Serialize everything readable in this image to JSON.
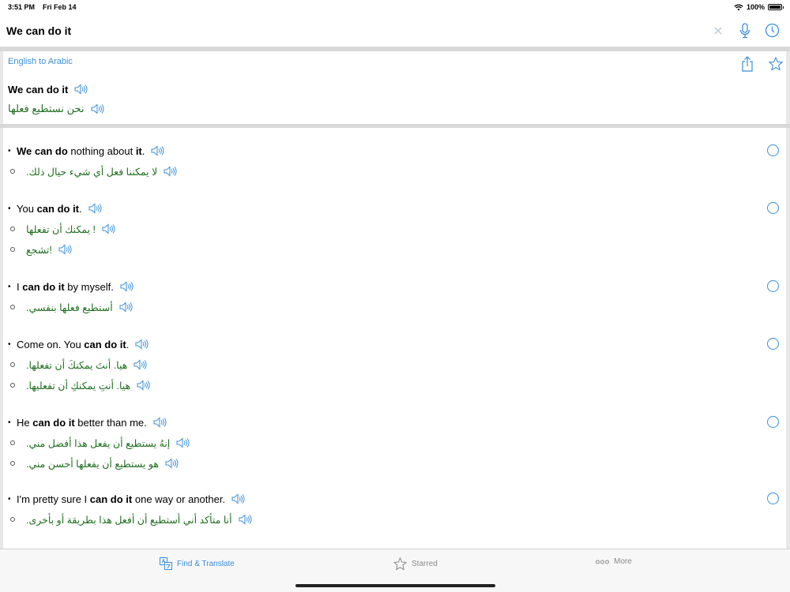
{
  "status_bar": {
    "time": "3:51 PM",
    "date": "Fri Feb 14",
    "battery": "100%"
  },
  "search": {
    "query": "We can do it"
  },
  "translation": {
    "direction": "English to Arabic",
    "source": "We can do it",
    "target": "نحن نستطيع فعلها"
  },
  "results": [
    {
      "en": [
        [
          "We can do",
          true
        ],
        [
          " nothing about ",
          false
        ],
        [
          "it",
          true
        ],
        [
          ".",
          false
        ]
      ],
      "ar": [
        ".لا يمكننا فعل أي شيء حيال ذلك"
      ]
    },
    {
      "en": [
        [
          "You ",
          false
        ],
        [
          "can do it",
          true
        ],
        [
          ".",
          false
        ]
      ],
      "ar": [
        "يمكنك أن تفعلها !",
        "تشجع!"
      ]
    },
    {
      "en": [
        [
          "I ",
          false
        ],
        [
          "can do it",
          true
        ],
        [
          " by myself.",
          false
        ]
      ],
      "ar": [
        ".أستطيع فعلها بنفسي"
      ]
    },
    {
      "en": [
        [
          "Come on. You ",
          false
        ],
        [
          "can do it",
          true
        ],
        [
          ".",
          false
        ]
      ],
      "ar": [
        ".هيا. أنتَ يمكنكَ أن تفعلها",
        ".هيا. أنتِ يمكنكِ أن تفعليها"
      ]
    },
    {
      "en": [
        [
          "He ",
          false
        ],
        [
          "can do it",
          true
        ],
        [
          " better than me.",
          false
        ]
      ],
      "ar": [
        ".إنهُ يستطيع أن يفعل هذا أفضل مني",
        ".هو يستطيع أن يفعلها أحسن مني"
      ]
    },
    {
      "en": [
        [
          "I'm pretty sure I ",
          false
        ],
        [
          "can do it",
          true
        ],
        [
          " one way or another.",
          false
        ]
      ],
      "ar": [
        ".أنا متأكد أني أستطيع أن أفعل هذا بطريقة أو بأخرى"
      ]
    }
  ],
  "tabs": [
    {
      "label": "Find & Translate",
      "icon": "translate-icon",
      "active": true
    },
    {
      "label": "Starred",
      "icon": "star-icon",
      "active": false
    },
    {
      "label": "More",
      "icon": "more-icon",
      "active": false
    }
  ],
  "colors": {
    "accent": "#3b8fd8",
    "arabic_text": "#1f6e1f"
  }
}
